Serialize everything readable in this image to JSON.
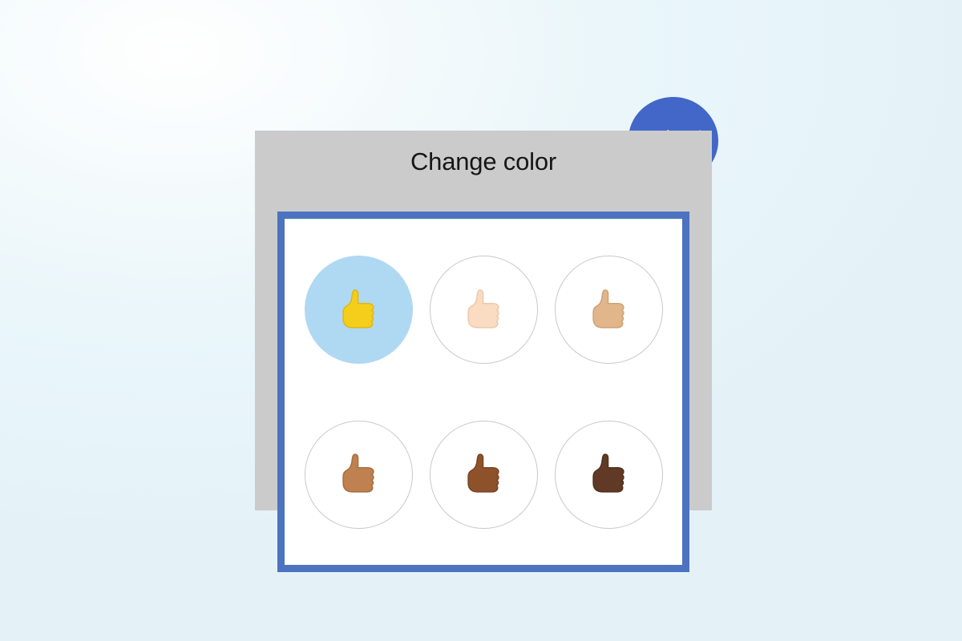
{
  "page": {
    "background_color": "#e4f2f8"
  },
  "dialog": {
    "title": "Change color",
    "subtitle": "",
    "card_color": "#cbcbcb",
    "panel_border_color": "#4c72c0",
    "panel_background": "#ffffff"
  },
  "brand": {
    "logo_name": "messenger-logo",
    "logo_color": "#4267c8",
    "bolt_color": "#e2e2e2"
  },
  "tone_picker": {
    "selected_index": 0,
    "selected_highlight_color": "#afd8f3",
    "unselected_border_color": "#c9c9c9",
    "options": [
      {
        "label": "Default yellow",
        "skin_color": "#f5ce1b",
        "shade_color": "#e0b912",
        "selected": true
      },
      {
        "label": "Light skin tone",
        "skin_color": "#f9dcc2",
        "shade_color": "#eecaab",
        "selected": false
      },
      {
        "label": "Medium-light skin tone",
        "skin_color": "#e0b68a",
        "shade_color": "#cfa277",
        "selected": false
      },
      {
        "label": "Medium skin tone",
        "skin_color": "#bf8150",
        "shade_color": "#a96e40",
        "selected": false
      },
      {
        "label": "Medium-dark skin tone",
        "skin_color": "#8e522b",
        "shade_color": "#7a4423",
        "selected": false
      },
      {
        "label": "Dark skin tone",
        "skin_color": "#613a25",
        "shade_color": "#50301e",
        "selected": false
      }
    ]
  }
}
